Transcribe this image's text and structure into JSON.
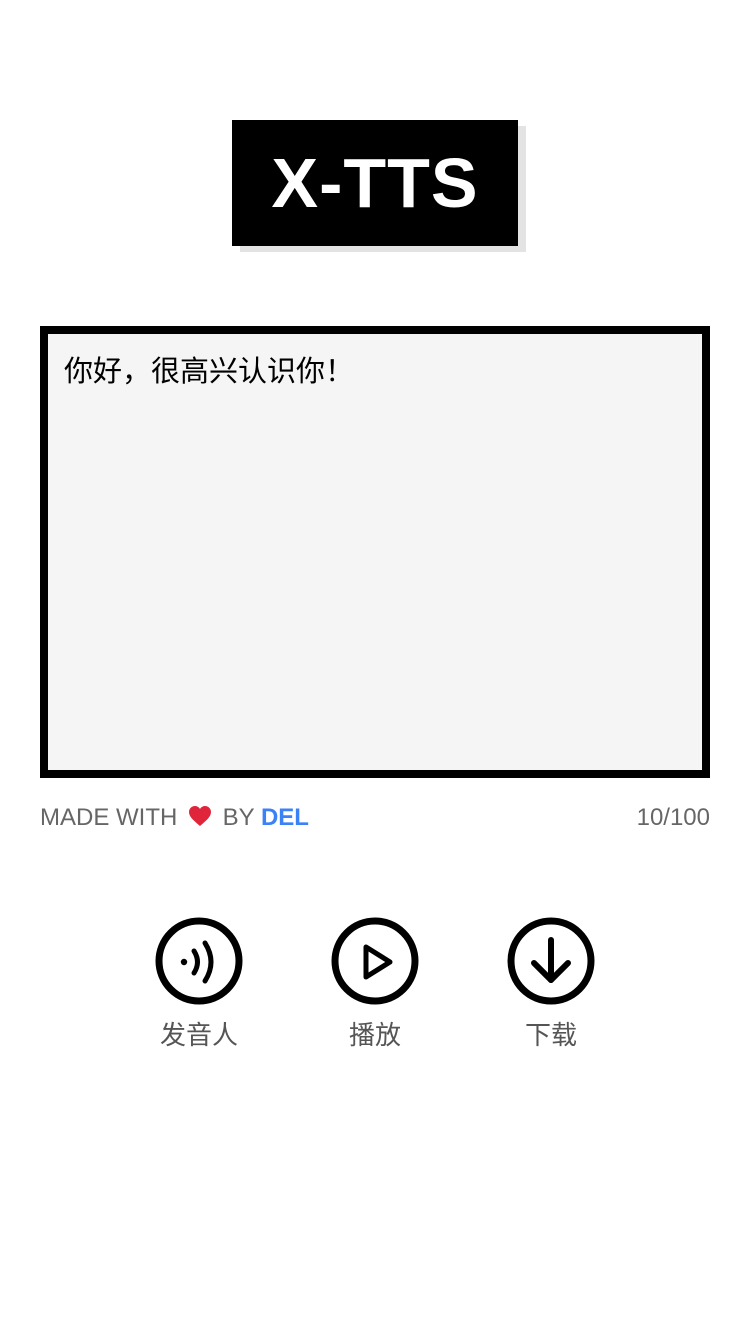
{
  "header": {
    "logo_text": "X-TTS"
  },
  "editor": {
    "text": "你好，很高兴认识你！"
  },
  "footer": {
    "credit_prefix": "MADE WITH",
    "credit_by": "BY",
    "credit_author": "DEL",
    "char_count": "10/100"
  },
  "actions": [
    {
      "label": "发音人",
      "icon": "speaker-waves-icon"
    },
    {
      "label": "播放",
      "icon": "play-icon"
    },
    {
      "label": "下载",
      "icon": "download-icon"
    }
  ],
  "colors": {
    "accent": "#3b82f6",
    "heart": "#e0243a",
    "border": "#000000",
    "editor_bg": "#f5f5f5"
  }
}
